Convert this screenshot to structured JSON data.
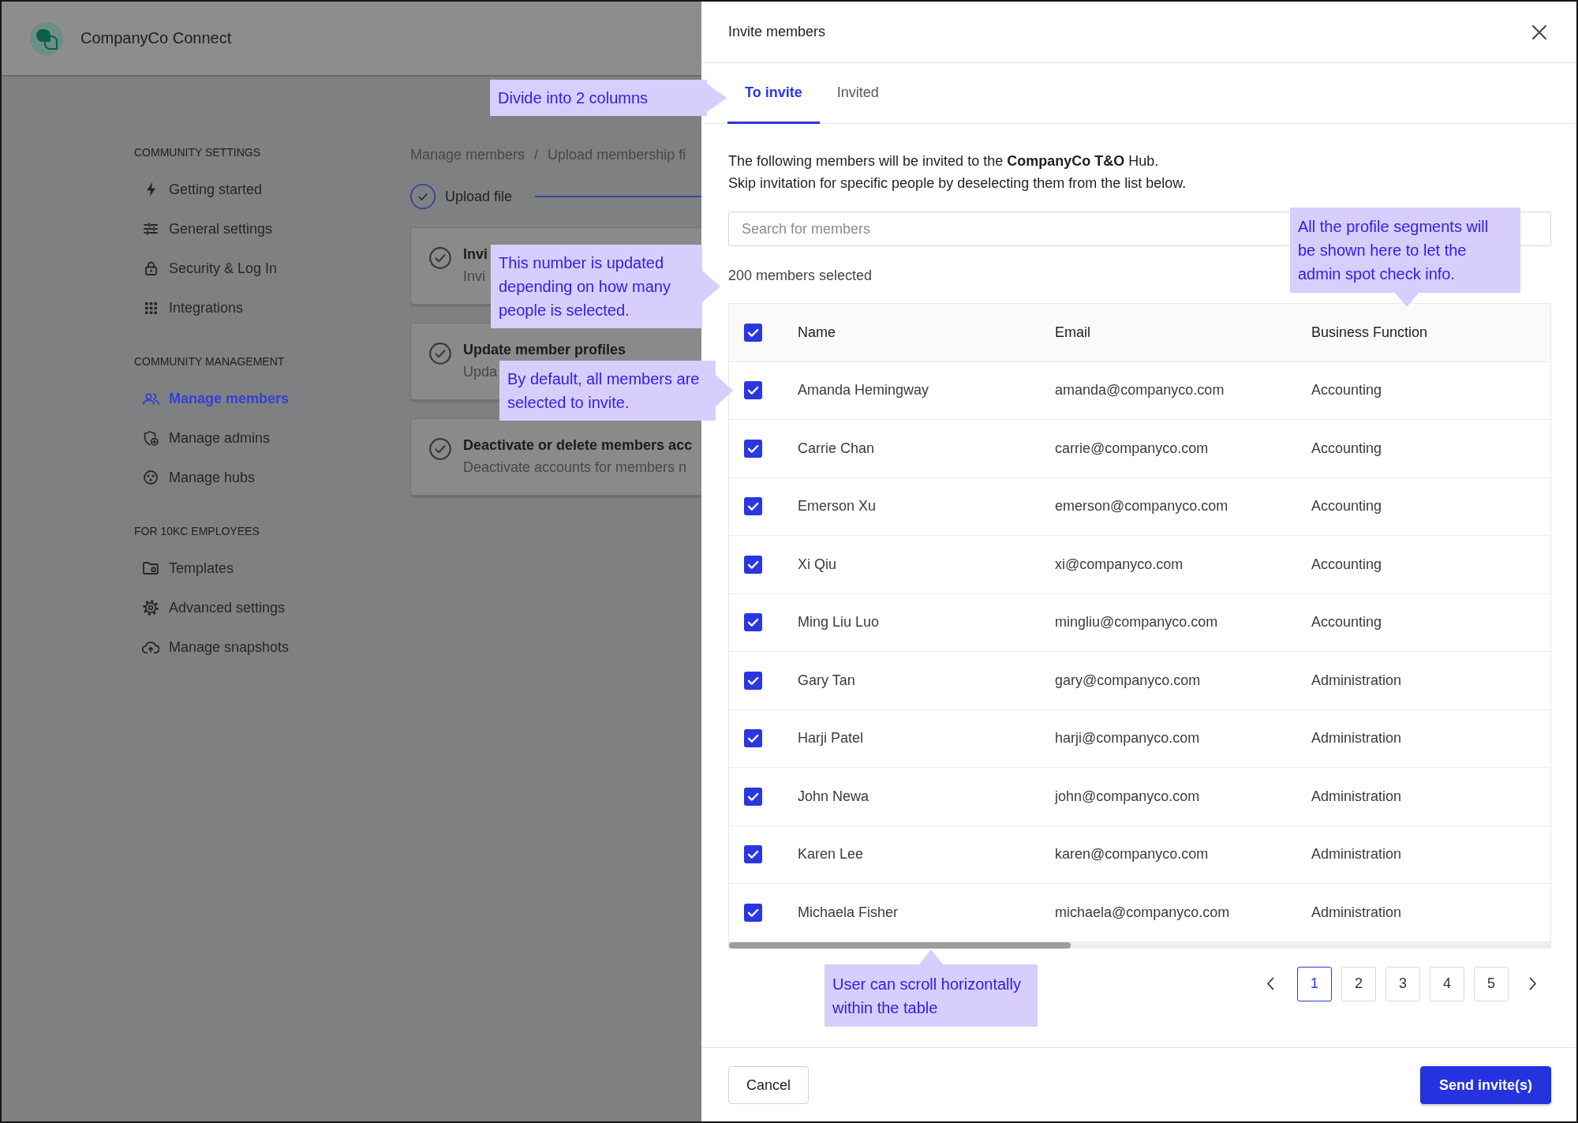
{
  "app": {
    "name": "CompanyCo Connect"
  },
  "sidebar": {
    "sections": [
      {
        "heading": "COMMUNITY SETTINGS",
        "items": [
          {
            "label": "Getting started",
            "selected": false
          },
          {
            "label": "General settings",
            "selected": false
          },
          {
            "label": "Security & Log In",
            "selected": false
          },
          {
            "label": "Integrations",
            "selected": false
          }
        ]
      },
      {
        "heading": "COMMUNITY MANAGEMENT",
        "items": [
          {
            "label": "Manage members",
            "selected": true
          },
          {
            "label": "Manage admins",
            "selected": false
          },
          {
            "label": "Manage hubs",
            "selected": false
          }
        ]
      },
      {
        "heading": "FOR 10KC EMPLOYEES",
        "items": [
          {
            "label": "Templates",
            "selected": false
          },
          {
            "label": "Advanced settings",
            "selected": false
          },
          {
            "label": "Manage snapshots",
            "selected": false
          }
        ]
      }
    ]
  },
  "main": {
    "breadcrumb": {
      "links": [
        "Manage members",
        "Upload membership fi"
      ],
      "separator": "/"
    },
    "stepper": {
      "steps": [
        {
          "label": "Upload file",
          "completed": true
        }
      ]
    },
    "tasks": [
      {
        "title": "Invi",
        "description": "Invi"
      },
      {
        "title": "Update member profiles",
        "description": "Upda"
      },
      {
        "title": "Deactivate or delete members acc",
        "description": "Deactivate accounts for members n"
      }
    ]
  },
  "dialog": {
    "title": "Invite members",
    "tabs": [
      {
        "label": "To invite",
        "selected": true
      },
      {
        "label": "Invited",
        "selected": false
      }
    ],
    "intro": [
      "The following members will be invited to the **CompanyCo T&O** Hub.",
      "Skip invitation for specific people by deselecting them from the list below."
    ],
    "search": {
      "placeholder": "Search for members"
    },
    "selection_count": "200 members selected",
    "table": {
      "all_checked": true,
      "columns": [
        "Name",
        "Email",
        "Business Function"
      ],
      "rows": [
        {
          "checked": true,
          "cells": [
            "Amanda Hemingway",
            "amanda@companyco.com",
            "Accounting"
          ]
        },
        {
          "checked": true,
          "cells": [
            "Carrie Chan",
            "carrie@companyco.com",
            "Accounting"
          ]
        },
        {
          "checked": true,
          "cells": [
            "Emerson Xu",
            "emerson@companyco.com",
            "Accounting"
          ]
        },
        {
          "checked": true,
          "cells": [
            "Xi Qiu",
            "xi@companyco.com",
            "Accounting"
          ]
        },
        {
          "checked": true,
          "cells": [
            "Ming Liu Luo",
            "mingliu@companyco.com",
            "Accounting"
          ]
        },
        {
          "checked": true,
          "cells": [
            "Gary Tan",
            "gary@companyco.com",
            "Administration"
          ]
        },
        {
          "checked": true,
          "cells": [
            "Harji Patel",
            "harji@companyco.com",
            "Administration"
          ]
        },
        {
          "checked": true,
          "cells": [
            "John Newa",
            "john@companyco.com",
            "Administration"
          ]
        },
        {
          "checked": true,
          "cells": [
            "Karen Lee",
            "karen@companyco.com",
            "Administration"
          ]
        },
        {
          "checked": true,
          "cells": [
            "Michaela Fisher",
            "michaela@companyco.com",
            "Administration"
          ]
        }
      ]
    },
    "pagination": {
      "pages": [
        {
          "label": "1",
          "selected": true
        },
        {
          "label": "2",
          "selected": false
        },
        {
          "label": "3",
          "selected": false
        },
        {
          "label": "4",
          "selected": false
        },
        {
          "label": "5",
          "selected": false
        }
      ]
    },
    "buttons": [
      {
        "label": "Cancel",
        "kind": "secondary"
      },
      {
        "label": "Send invite(s)",
        "kind": "primary"
      }
    ]
  },
  "annotations": [
    "Divide into 2 columns",
    "This number is updated depending on how many people is selected.",
    "By default, all members are selected to invite.",
    "All the profile segments will be shown here to let the admin spot check info.",
    "User can scroll horizontally within the table"
  ]
}
